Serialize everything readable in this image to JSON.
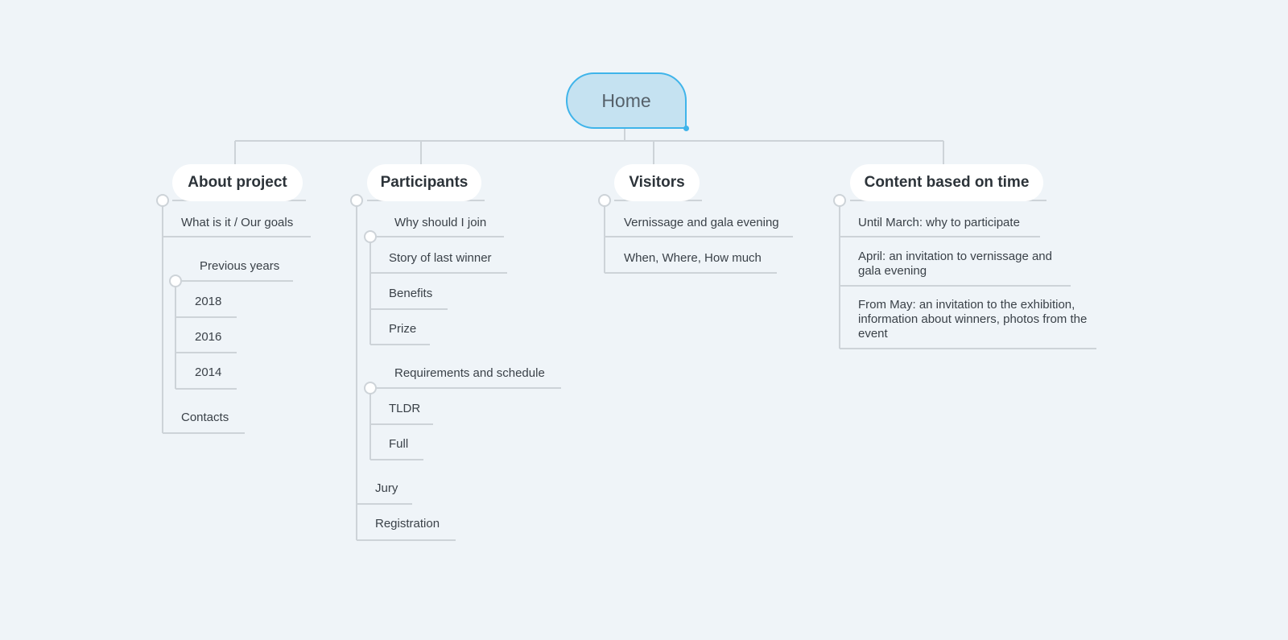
{
  "root": {
    "label": "Home"
  },
  "branches": [
    {
      "label": "About project",
      "items": [
        {
          "label": "What is it / Our goals"
        },
        {
          "label": "Previous years",
          "children": [
            "2018",
            "2016",
            "2014"
          ]
        },
        {
          "label": "Contacts"
        }
      ]
    },
    {
      "label": "Participants",
      "items": [
        {
          "label": "Why should I join",
          "children": [
            "Story of last winner",
            "Benefits",
            "Prize"
          ]
        },
        {
          "label": "Requirements and schedule",
          "children": [
            "TLDR",
            "Full"
          ]
        },
        {
          "label": "Jury"
        },
        {
          "label": "Registration"
        }
      ]
    },
    {
      "label": "Visitors",
      "items": [
        {
          "label": "Vernissage and gala evening"
        },
        {
          "label": "When, Where, How much"
        }
      ]
    },
    {
      "label": "Content based on time",
      "items": [
        {
          "label": "Until March: why to participate"
        },
        {
          "label": "April: an invitation to vernissage and gala evening"
        },
        {
          "label": "From May: an invitation to the exhibition, information about winners, photos from the event"
        }
      ]
    }
  ]
}
